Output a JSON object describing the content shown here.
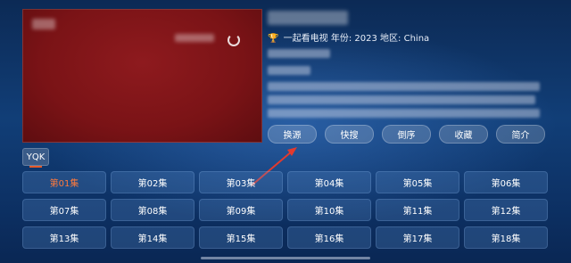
{
  "detail": {
    "meta_prefix": "一起看电视",
    "year_label": "年份:",
    "year": "2023",
    "region_label": "地区:",
    "region": "China"
  },
  "actions": [
    "换源",
    "快搜",
    "倒序",
    "收藏",
    "简介"
  ],
  "source": {
    "label": "YQK"
  },
  "episodes": [
    "第01集",
    "第02集",
    "第03集",
    "第04集",
    "第05集",
    "第06集",
    "第07集",
    "第08集",
    "第09集",
    "第10集",
    "第11集",
    "第12集",
    "第13集",
    "第14集",
    "第15集",
    "第16集",
    "第17集",
    "第18集"
  ],
  "active_episode_index": 0,
  "colors": {
    "accent": "#e55b2b",
    "active_text": "#ff7a3d",
    "player_bg": "#7a1316"
  }
}
